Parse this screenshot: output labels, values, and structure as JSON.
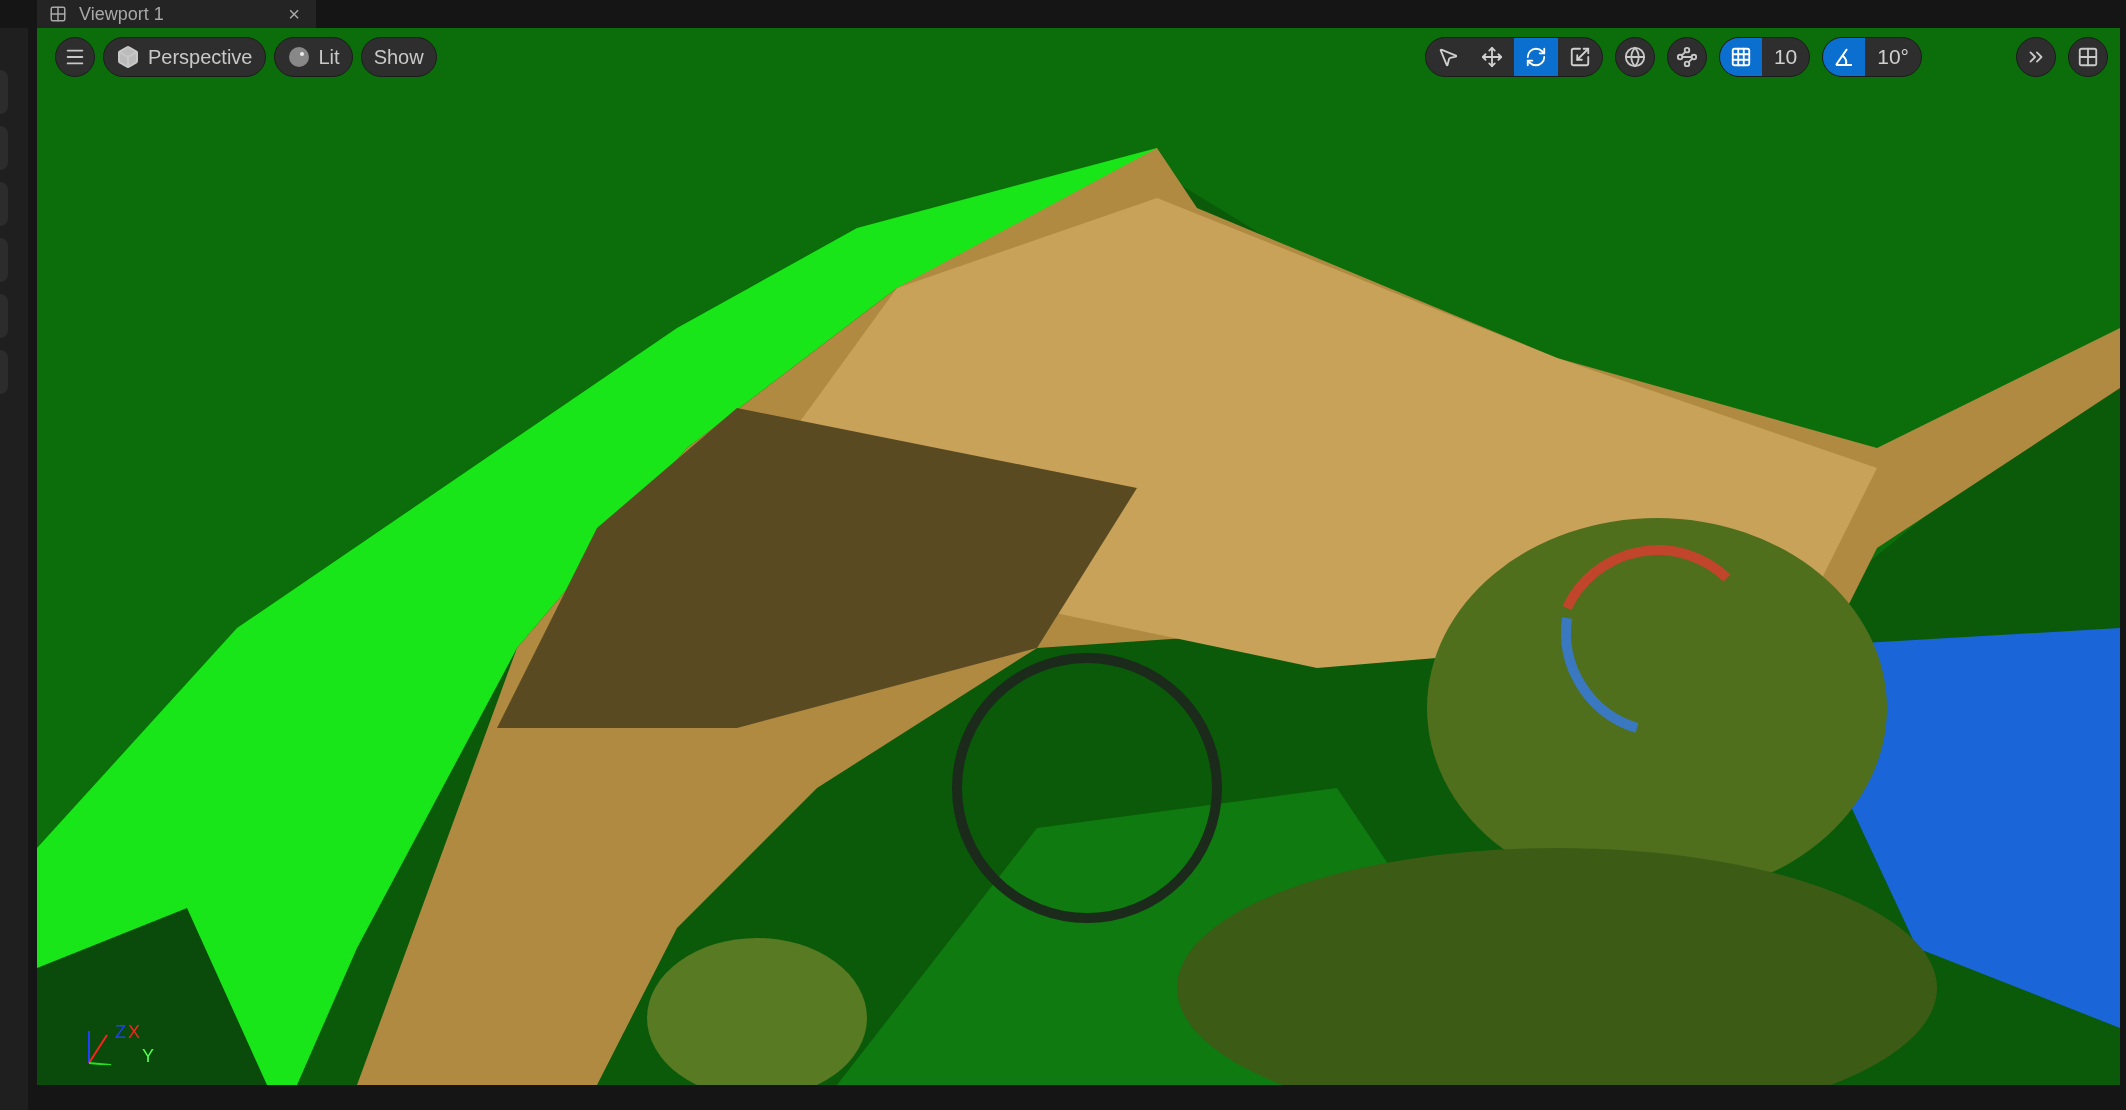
{
  "tab": {
    "title": "Viewport 1",
    "close": "×"
  },
  "toolbar": {
    "view_mode": "Perspective",
    "lighting": "Lit",
    "show": "Show"
  },
  "transform_tools": [
    {
      "kind": "select",
      "selected": false
    },
    {
      "kind": "translate",
      "selected": false
    },
    {
      "kind": "rotate",
      "selected": true
    },
    {
      "kind": "scale",
      "selected": false
    }
  ],
  "grid_snap": {
    "on": true,
    "value": "10"
  },
  "rotation_snap": {
    "on": true,
    "value": "10°"
  },
  "axis_gizmo": {
    "z": "Z",
    "x": "X",
    "y": "Y"
  }
}
